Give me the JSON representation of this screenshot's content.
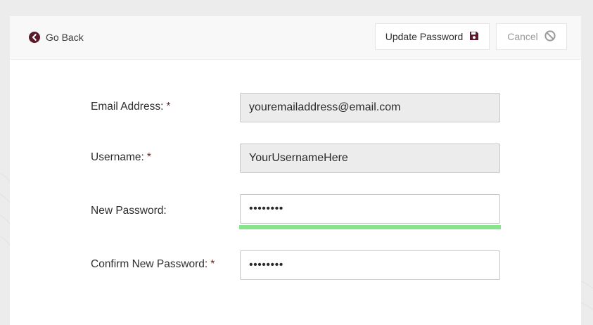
{
  "toolbar": {
    "go_back_label": "Go Back",
    "update_label": "Update Password",
    "cancel_label": "Cancel"
  },
  "form": {
    "email": {
      "label": "Email Address:",
      "required_mark": "*",
      "value": "youremailaddress@email.com"
    },
    "username": {
      "label": "Username:",
      "required_mark": "*",
      "value": "YourUsernameHere"
    },
    "new_password": {
      "label": "New Password:",
      "value": "••••••••",
      "strength_fraction": 1.0
    },
    "confirm_password": {
      "label": "Confirm New Password:",
      "required_mark": "*",
      "value": "••••••••"
    }
  },
  "icons": {
    "back": "chevron-left-circle-icon",
    "save": "floppy-disk-icon",
    "cancel": "ban-icon"
  },
  "colors": {
    "accent": "#5a1a2c",
    "required": "#7a1c1c",
    "strength": "#86e58a",
    "readonly_bg": "#ececec"
  }
}
